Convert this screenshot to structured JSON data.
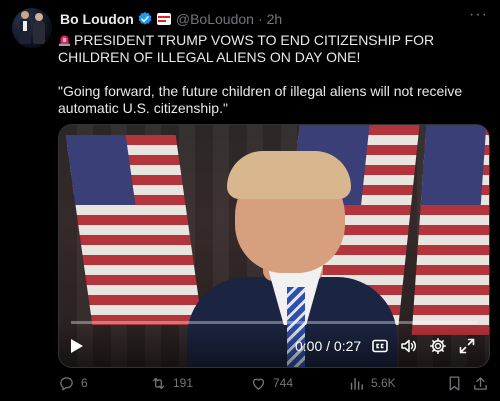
{
  "post": {
    "author_name": "Bo Loudon",
    "handle": "@BoLoudon",
    "separator": "·",
    "time": "2h",
    "more": "···",
    "text_line1": "PRESIDENT TRUMP VOWS TO END CITIZENSHIP FOR CHILDREN OF ILLEGAL ALIENS ON DAY ONE!",
    "text_line2": "\"Going forward, the future children of illegal aliens will not receive automatic U.S. citizenship.\""
  },
  "video": {
    "time_display": "0:00 / 0:27",
    "progress": 0,
    "controls": [
      "play-icon",
      "captions-icon",
      "volume-icon",
      "settings-icon",
      "fullscreen-icon"
    ]
  },
  "actions": {
    "replies": "6",
    "reposts": "191",
    "likes": "744",
    "views": "5.6K"
  },
  "colors": {
    "background": "#000000",
    "text": "#e7e9ea",
    "muted": "#71767b",
    "verified": "#1d9bf0"
  }
}
